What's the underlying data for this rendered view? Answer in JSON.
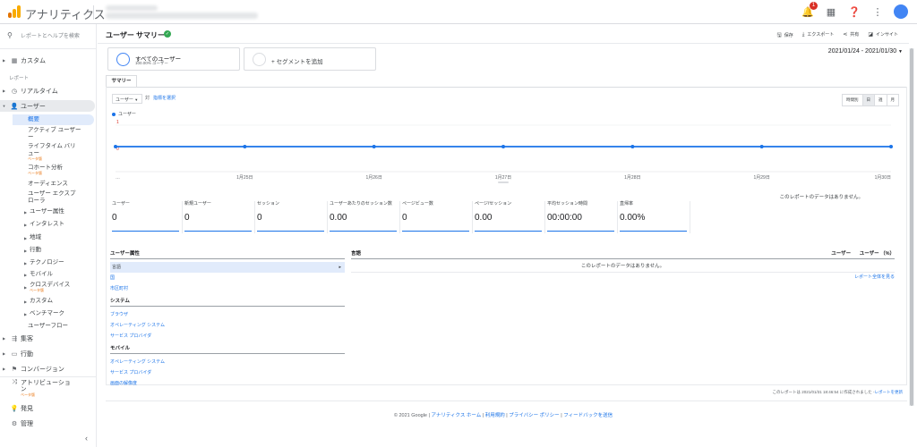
{
  "app": {
    "title": "アナリティクス"
  },
  "sidebar": {
    "search_placeholder": "レポートとヘルプを検索",
    "custom": "カスタム",
    "reports_label": "レポート",
    "realtime": "リアルタイム",
    "audience": "ユーザー",
    "audience_sub": {
      "overview": "概要",
      "active_users": "アクティブ ユーザー",
      "active_users_2": "ー",
      "lifetime": "ライフタイム バリ",
      "lifetime_2": "ュー",
      "cohort": "コホート分析",
      "audiences": "オーディエンス",
      "user_explorer": "ユーザー エクスプ",
      "user_explorer_2": "ローラ",
      "demographics": "ユーザー属性",
      "interests": "インタレスト",
      "geo": "地域",
      "behavior": "行動",
      "technology": "テクノロジー",
      "mobile": "モバイル",
      "cross_device": "クロスデバイス",
      "custom": "カスタム",
      "benchmark": "ベンチマーク",
      "user_flow": "ユーザーフロー"
    },
    "beta": "ベータ版",
    "acquisition": "集客",
    "behavior": "行動",
    "conversions": "コンバージョン",
    "attribution": "アトリビューショ",
    "attribution_2": "ン",
    "discover": "発見",
    "admin": "管理"
  },
  "header": {
    "page_title": "ユーザー サマリー",
    "actions": {
      "save": "保存",
      "export": "エクスポート",
      "share": "共有",
      "insights": "インサイト"
    }
  },
  "segments": {
    "all_users": "すべてのユーザー",
    "all_users_sub": "100.00% ユーザー",
    "add_segment": "+ セグメントを追加"
  },
  "date_range": "2021/01/24 - 2021/01/30",
  "tabs": {
    "summary": "サマリー"
  },
  "chart_controls": {
    "metric": "ユーザー",
    "vs": "対",
    "select_metric": "指標を選択",
    "granularity": [
      "時間別",
      "日",
      "週",
      "月"
    ],
    "selected_granularity": "日"
  },
  "chart_data": {
    "type": "line",
    "x": [
      "…",
      "1月25日",
      "1月26日",
      "1月27日",
      "1月28日",
      "1月29日",
      "1月30日"
    ],
    "series": [
      {
        "name": "ユーザー",
        "values": [
          0,
          0,
          0,
          0,
          0,
          0,
          0
        ]
      }
    ],
    "y_ticks": [
      "1",
      "0"
    ],
    "ylim": [
      0,
      1
    ],
    "grid": true,
    "color": "#1a73e8"
  },
  "no_data_message": "このレポートのデータはありません。",
  "scorecards": [
    {
      "label": "ユーザー",
      "value": "0"
    },
    {
      "label": "新規ユーザー",
      "value": "0"
    },
    {
      "label": "セッション",
      "value": "0"
    },
    {
      "label": "ユーザーあたりのセッション数",
      "value": "0.00"
    },
    {
      "label": "ページビュー数",
      "value": "0"
    },
    {
      "label": "ページ/セッション",
      "value": "0.00"
    },
    {
      "label": "平均セッション時間",
      "value": "00:00:00"
    },
    {
      "label": "直帰率",
      "value": "0.00%"
    }
  ],
  "dimensions": {
    "demographics": {
      "title": "ユーザー属性",
      "items": [
        "言語",
        "国",
        "市区町村"
      ]
    },
    "system": {
      "title": "システム",
      "items": [
        "ブラウザ",
        "オペレーティング システム",
        "サービス プロバイダ"
      ]
    },
    "mobile": {
      "title": "モバイル",
      "items": [
        "オペレーティング システム",
        "サービス プロバイダ",
        "画面の解像度"
      ]
    }
  },
  "right_table": {
    "column": "言語",
    "metric_cols": [
      "ユーザー",
      "ユーザー （%）"
    ],
    "empty": "このレポートのデータはありません。",
    "full_report": "レポート全体を見る"
  },
  "generated": {
    "text": "このレポートは 2021/01/31 18:46:54 に作成されました -",
    "link": "レポートを更新"
  },
  "footer": {
    "copyright": "© 2021 Google",
    "links": [
      "アナリティクス ホーム",
      "利用規約",
      "プライバシー ポリシー",
      "フィードバックを送信"
    ]
  },
  "colors": {
    "accent": "#1a73e8",
    "logo_orange": "#f9ab00",
    "logo_dark": "#e37400",
    "verified": "#34a853"
  }
}
